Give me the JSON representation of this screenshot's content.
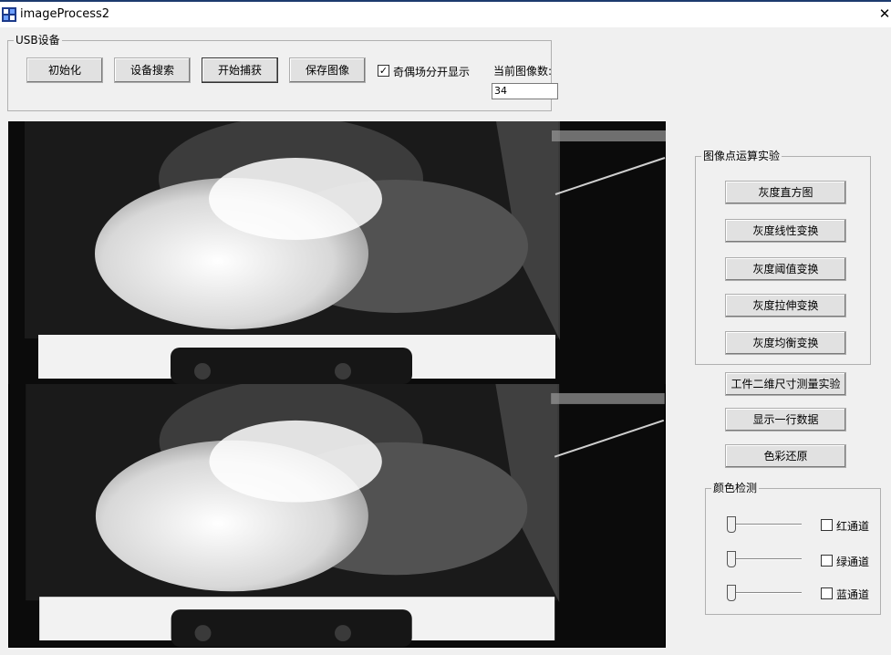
{
  "window": {
    "title": "imageProcess2",
    "close_glyph": "✕"
  },
  "usb_group": {
    "title": "USB设备",
    "buttons": {
      "init": "初始化",
      "search": "设备搜索",
      "capture": "开始捕获",
      "save": "保存图像"
    },
    "field_split_label": "奇偶场分开显示",
    "field_split_checked": true,
    "image_count_label": "当前图像数:",
    "image_count_value": "34"
  },
  "point_ops_group": {
    "title": "图像点运算实验",
    "buttons": [
      "灰度直方图",
      "灰度线性变换",
      "灰度阈值变换",
      "灰度拉伸变换",
      "灰度均衡变换"
    ]
  },
  "extra_buttons": [
    "工件二维尺寸测量实验",
    "显示一行数据",
    "色彩还原"
  ],
  "color_group": {
    "title": "颜色检测",
    "channels": [
      {
        "label": "红通道",
        "checked": false,
        "level": 0
      },
      {
        "label": "绿通道",
        "checked": false,
        "level": 0
      },
      {
        "label": "蓝通道",
        "checked": false,
        "level": 0
      }
    ]
  }
}
